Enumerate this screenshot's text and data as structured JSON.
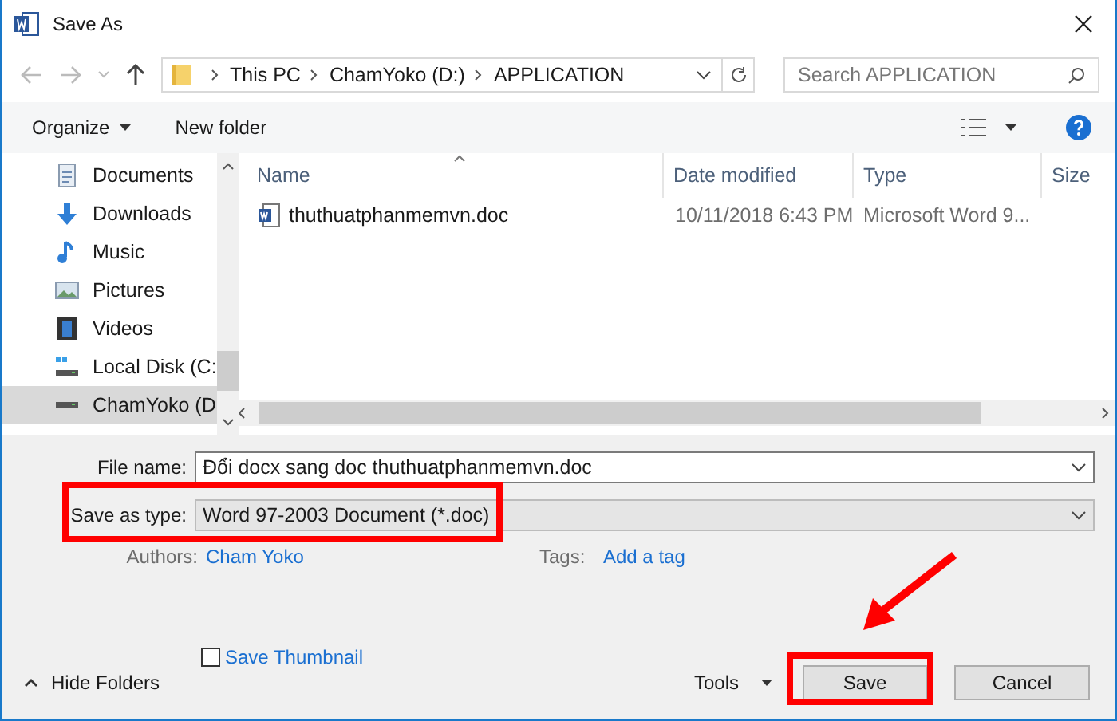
{
  "window": {
    "title": "Save As"
  },
  "address": {
    "crumbs": [
      "This PC",
      "ChamYoko (D:)",
      "APPLICATION"
    ]
  },
  "search": {
    "placeholder": "Search APPLICATION"
  },
  "toolbar": {
    "organize": "Organize",
    "new_folder": "New folder"
  },
  "sidebar": {
    "items": [
      {
        "kind": "documents",
        "label": "Documents",
        "selected": false
      },
      {
        "kind": "downloads",
        "label": "Downloads",
        "selected": false
      },
      {
        "kind": "music",
        "label": "Music",
        "selected": false
      },
      {
        "kind": "pictures",
        "label": "Pictures",
        "selected": false
      },
      {
        "kind": "videos",
        "label": "Videos",
        "selected": false
      },
      {
        "kind": "system-drive",
        "label": "Local Disk (C:",
        "selected": false
      },
      {
        "kind": "drive",
        "label": "ChamYoko (D",
        "selected": true
      }
    ]
  },
  "table": {
    "columns": [
      "Name",
      "Date modified",
      "Type",
      "Size"
    ],
    "rows": [
      {
        "name": "thuthuatphanmemvn.doc",
        "date": "10/11/2018 6:43 PM",
        "type": "Microsoft Word 9..."
      }
    ]
  },
  "form": {
    "file_name_label": "File name:",
    "file_name": "Đổi docx sang doc thuthuatphanmemvn.doc",
    "type_label": "Save as type:",
    "type_value": "Word 97-2003 Document (*.doc)",
    "authors_label": "Authors:",
    "authors": "Cham Yoko",
    "tags_label": "Tags:",
    "tags": "Add a tag",
    "thumbnail": {
      "label": "Save Thumbnail",
      "checked": false
    }
  },
  "footer": {
    "hide_folders": "Hide Folders",
    "tools": "Tools",
    "save": "Save",
    "cancel": "Cancel"
  },
  "annotations": {
    "highlight_type": true,
    "highlight_save": true,
    "arrow": true
  }
}
